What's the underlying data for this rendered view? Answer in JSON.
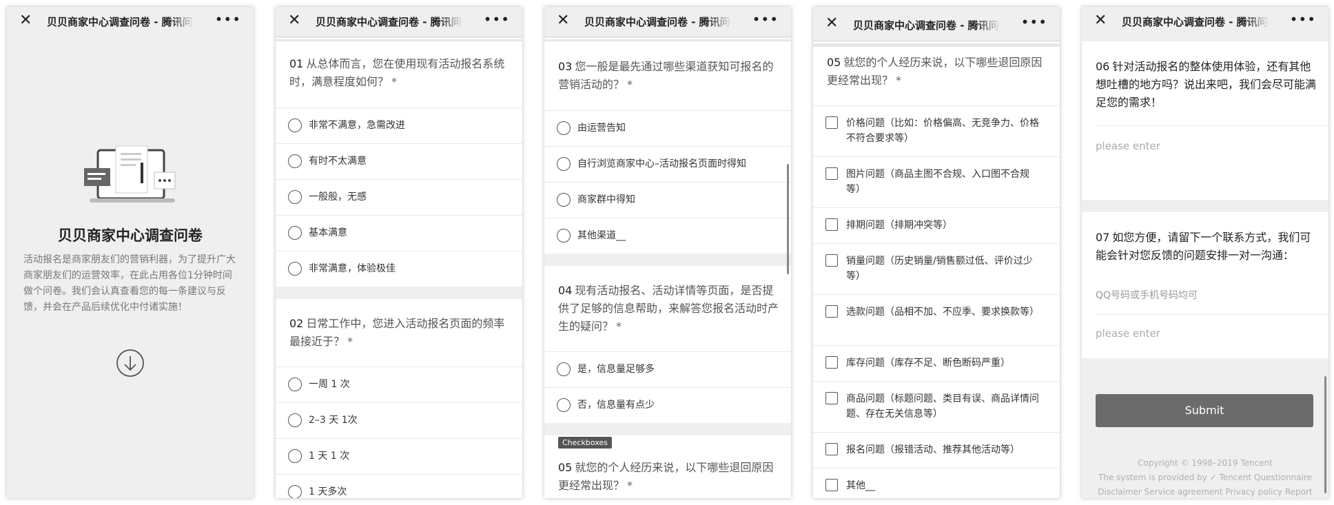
{
  "nav": {
    "title": "贝贝商家中心调查问卷 - 腾讯问卷",
    "close_icon": "close-icon",
    "more_icon": "more-icon"
  },
  "screen1": {
    "heading": "贝贝商家中心调查问卷",
    "description": "活动报名是商家朋友们的营销利器，为了提升广大商家朋友们的运营效率，在此占用各位1分钟时间做个问卷。我们会认真查看您的每一条建议与反馈，并会在产品后续优化中付诸实施！",
    "icon": "laptop-survey-illustration",
    "scroll_icon": "arrow-down-circle-icon"
  },
  "screen2": {
    "q1": {
      "num": "01",
      "text": "从总体而言，您在使用现有活动报名系统时，满意程度如何？",
      "req": "*",
      "options": [
        "非常不满意，急需改进",
        "有时不太满意",
        "一般般，无感",
        "基本满意",
        "非常满意，体验极佳"
      ]
    },
    "q2": {
      "num": "02",
      "text": "日常工作中，您进入活动报名页面的频率最接近于？",
      "req": "*",
      "options": [
        "一周 1 次",
        "2–3 天 1次",
        "1 天 1 次",
        "1 天多次"
      ]
    }
  },
  "screen3": {
    "q3": {
      "num": "03",
      "text": "您一般是最先通过哪些渠道获知可报名的营销活动的？",
      "req": "*",
      "options": [
        "由运营告知",
        "自行浏览商家中心–活动报名页面时得知",
        "商家群中得知",
        "其他渠道__"
      ]
    },
    "q4": {
      "num": "04",
      "text": "现有活动报名、活动详情等页面，是否提供了足够的信息帮助，来解答您报名活动时产生的疑问？",
      "req": "*",
      "options": [
        "是，信息量足够多",
        "否，信息量有点少"
      ]
    },
    "badge": "Checkboxes",
    "q5": {
      "num": "05",
      "text": "就您的个人经历来说，以下哪些退回原因更经常出现？",
      "req": "*"
    }
  },
  "screen4": {
    "q5": {
      "num": "05",
      "text": "就您的个人经历来说，以下哪些退回原因更经常出现？",
      "req": "*",
      "options": [
        "价格问题（比如：价格偏高、无竞争力、价格不符合要求等）",
        "图片问题（商品主图不合规、入口图不合规等）",
        "排期问题（排期冲突等）",
        "销量问题（历史销量/销售额过低、评价过少等）",
        "选款问题（品相不加、不应季、要求换款等）",
        "库存问题（库存不足、断色断码严重）",
        "商品问题（标题问题、类目有误、商品详情问题、存在无关信息等）",
        "报名问题（报错活动、推荐其他活动等）",
        "其他__"
      ]
    }
  },
  "screen5": {
    "q6": {
      "num": "06",
      "text": "针对活动报名的整体使用体验，还有其他想吐槽的地方吗？说出来吧，我们会尽可能满足您的需求！",
      "placeholder": "please enter"
    },
    "q7": {
      "num": "07",
      "text": "如您方便，请留下一个联系方式，我们可能会针对您反馈的问题安排一对一沟通：",
      "hint": "QQ号码或手机号码均可",
      "placeholder": "please enter"
    },
    "submit": "Submit",
    "footer": {
      "copyright": "Copyright © 1998–2019 Tencent",
      "provided": "The system is provided by",
      "brand": "Tencent Questionnaire",
      "links": "Disclaimer Service agreement Privacy policy Report"
    }
  },
  "colors": {
    "nav_bg": "#efefef",
    "band": "#efefef",
    "submit_bg": "#6b6b6b"
  }
}
